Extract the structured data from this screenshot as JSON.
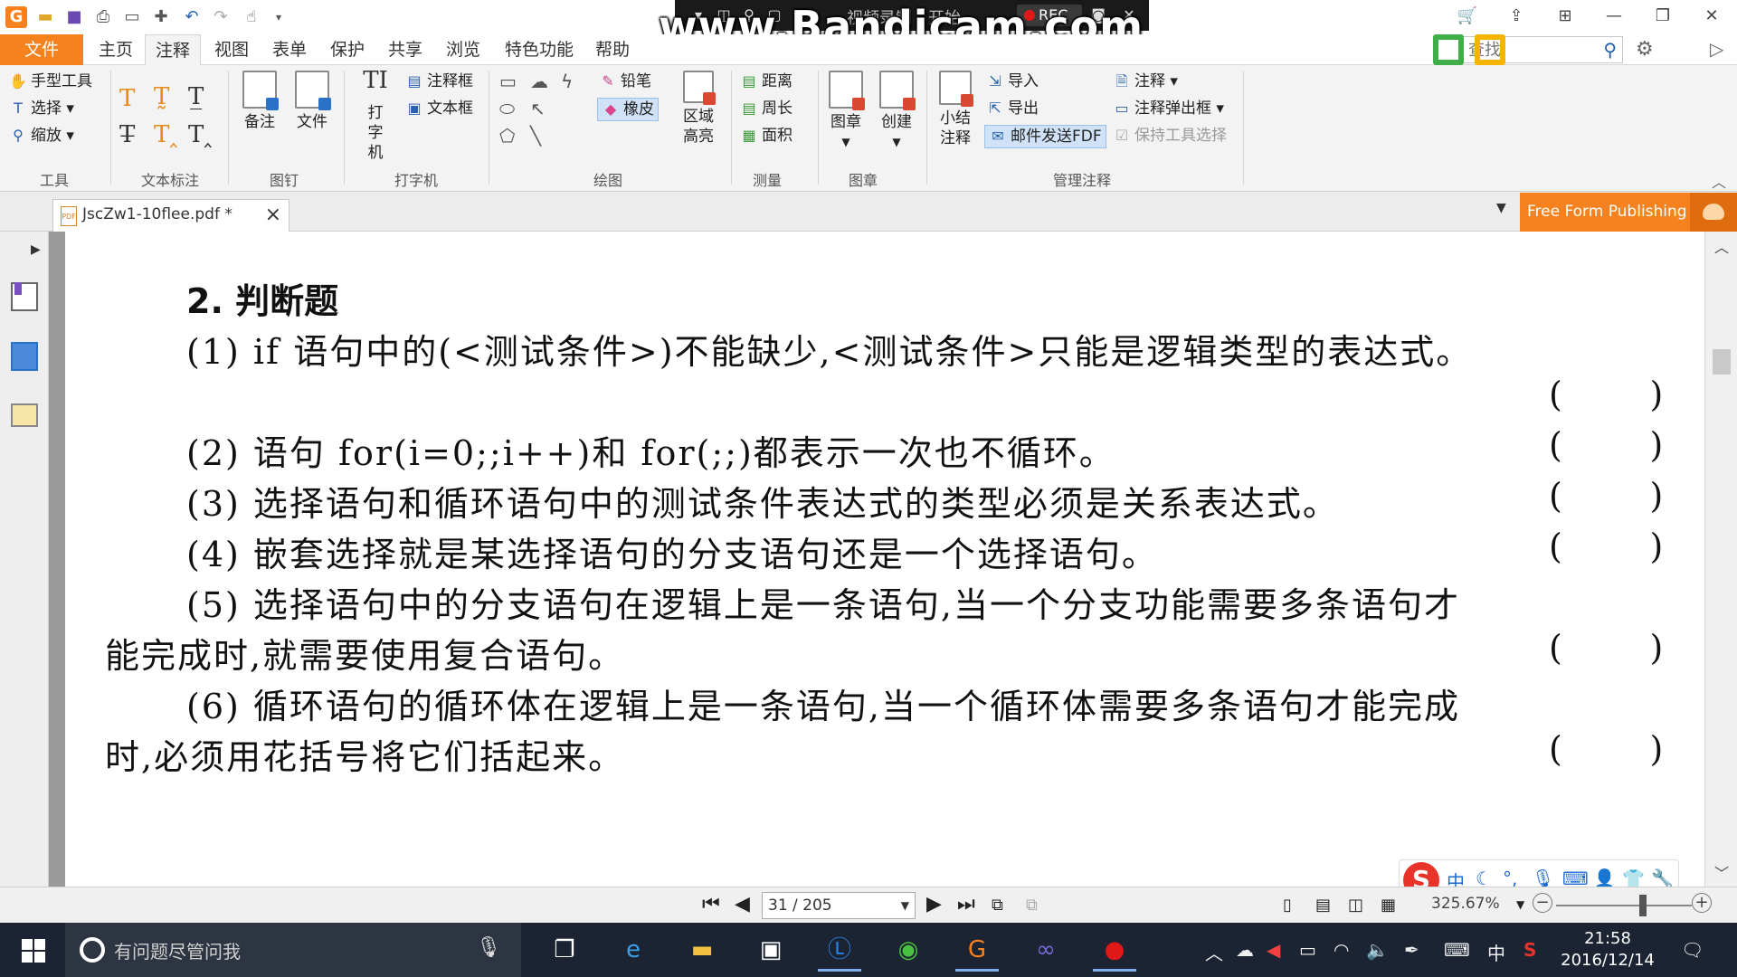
{
  "window": {
    "quick_access": [
      "app-logo",
      "open",
      "save",
      "print",
      "scan",
      "new",
      "undo",
      "redo",
      "hand"
    ],
    "controls": [
      "cart",
      "share",
      "layout",
      "minimize",
      "maximize",
      "close"
    ]
  },
  "bandicam": {
    "title": "视频录制 - 开始",
    "rec_label": "REC",
    "watermark": "www.Bandicam.com"
  },
  "menu": {
    "tabs": [
      "文件",
      "主页",
      "注释",
      "视图",
      "表单",
      "保护",
      "共享",
      "浏览",
      "特色功能",
      "帮助"
    ],
    "active": "注释",
    "search_placeholder": "查找"
  },
  "ribbon": {
    "tools": {
      "hand": "手型工具",
      "select": "选择",
      "zoom": "缩放",
      "label": "工具"
    },
    "text_markup": {
      "label": "文本标注"
    },
    "pin": {
      "note": "备注",
      "file": "文件",
      "label": "图钉"
    },
    "typewriter": {
      "typewriter": "打字机",
      "callout": "注释框",
      "textbox": "文本框",
      "label": "打字机"
    },
    "drawing": {
      "pencil": "铅笔",
      "eraser": "橡皮",
      "area_highlight": "区域高亮",
      "label": "绘图"
    },
    "measure": {
      "distance": "距离",
      "perimeter": "周长",
      "area": "面积",
      "label": "测量"
    },
    "stamp": {
      "stamp": "图章",
      "create": "创建",
      "label": "图章"
    },
    "manage": {
      "summary": "小结注释",
      "import": "导入",
      "export": "导出",
      "email_fdf": "邮件发送FDF",
      "comments": "注释",
      "popup": "注释弹出框",
      "keep_tool": "保持工具选择",
      "label": "管理注释"
    }
  },
  "document_tab": {
    "name": "JscZw1-10flee.pdf *",
    "promo": "Free Form Publishing"
  },
  "document": {
    "heading": "2. 判断题",
    "lines": [
      "(1) if 语句中的(<测试条件>)不能缺少,<测试条件>只能是逻辑类型的表达式。",
      "(2) 语句 for(i=0;;i++)和 for(;;)都表示一次也不循环。",
      "(3) 选择语句和循环语句中的测试条件表达式的类型必须是关系表达式。",
      "(4) 嵌套选择就是某选择语句的分支语句还是一个选择语句。",
      "(5) 选择语句中的分支语句在逻辑上是一条语句,当一个分支功能需要多条语句才",
      "能完成时,就需要使用复合语句。",
      "(6) 循环语句的循环体在逻辑上是一条语句,当一个循环体需要多条语句才能完成",
      "时,必须用花括号将它们括起来。"
    ],
    "answer_blank": "(        )"
  },
  "status": {
    "page": "31 / 205",
    "zoom": "325.67%"
  },
  "ime": {
    "mode": "中"
  },
  "taskbar": {
    "search_placeholder": "有问题尽管问我",
    "ime_indicator": "中",
    "time": "21:58",
    "date": "2016/12/14"
  },
  "colors": {
    "accent": "#f5821f",
    "ribbon_bg": "#f3f3f3",
    "taskbar": "#1c2433"
  }
}
